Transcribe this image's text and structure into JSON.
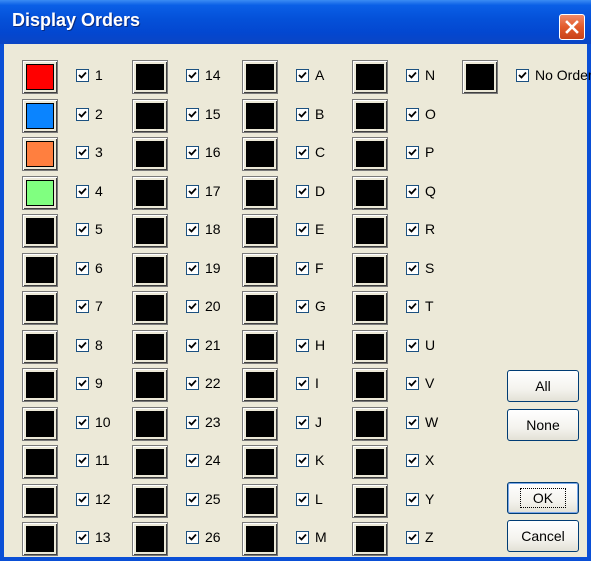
{
  "window": {
    "title": "Display Orders"
  },
  "colors": {
    "title_bar": "#0450d8",
    "close_button": "#e25a2a",
    "face": "#ece9d8"
  },
  "icons": {
    "close": "close-x-icon",
    "check": "checkmark-icon"
  },
  "orders": [
    {
      "label": "1",
      "color": "#ff0000",
      "checked": true
    },
    {
      "label": "2",
      "color": "#0a84ff",
      "checked": true
    },
    {
      "label": "3",
      "color": "#ff7f3f",
      "checked": true
    },
    {
      "label": "4",
      "color": "#80ff80",
      "checked": true
    },
    {
      "label": "5",
      "color": "#000000",
      "checked": true
    },
    {
      "label": "6",
      "color": "#000000",
      "checked": true
    },
    {
      "label": "7",
      "color": "#000000",
      "checked": true
    },
    {
      "label": "8",
      "color": "#000000",
      "checked": true
    },
    {
      "label": "9",
      "color": "#000000",
      "checked": true
    },
    {
      "label": "10",
      "color": "#000000",
      "checked": true
    },
    {
      "label": "11",
      "color": "#000000",
      "checked": true
    },
    {
      "label": "12",
      "color": "#000000",
      "checked": true
    },
    {
      "label": "13",
      "color": "#000000",
      "checked": true
    },
    {
      "label": "14",
      "color": "#000000",
      "checked": true
    },
    {
      "label": "15",
      "color": "#000000",
      "checked": true
    },
    {
      "label": "16",
      "color": "#000000",
      "checked": true
    },
    {
      "label": "17",
      "color": "#000000",
      "checked": true
    },
    {
      "label": "18",
      "color": "#000000",
      "checked": true
    },
    {
      "label": "19",
      "color": "#000000",
      "checked": true
    },
    {
      "label": "20",
      "color": "#000000",
      "checked": true
    },
    {
      "label": "21",
      "color": "#000000",
      "checked": true
    },
    {
      "label": "22",
      "color": "#000000",
      "checked": true
    },
    {
      "label": "23",
      "color": "#000000",
      "checked": true
    },
    {
      "label": "24",
      "color": "#000000",
      "checked": true
    },
    {
      "label": "25",
      "color": "#000000",
      "checked": true
    },
    {
      "label": "26",
      "color": "#000000",
      "checked": true
    },
    {
      "label": "A",
      "color": "#000000",
      "checked": true
    },
    {
      "label": "B",
      "color": "#000000",
      "checked": true
    },
    {
      "label": "C",
      "color": "#000000",
      "checked": true
    },
    {
      "label": "D",
      "color": "#000000",
      "checked": true
    },
    {
      "label": "E",
      "color": "#000000",
      "checked": true
    },
    {
      "label": "F",
      "color": "#000000",
      "checked": true
    },
    {
      "label": "G",
      "color": "#000000",
      "checked": true
    },
    {
      "label": "H",
      "color": "#000000",
      "checked": true
    },
    {
      "label": "I",
      "color": "#000000",
      "checked": true
    },
    {
      "label": "J",
      "color": "#000000",
      "checked": true
    },
    {
      "label": "K",
      "color": "#000000",
      "checked": true
    },
    {
      "label": "L",
      "color": "#000000",
      "checked": true
    },
    {
      "label": "M",
      "color": "#000000",
      "checked": true
    },
    {
      "label": "N",
      "color": "#000000",
      "checked": true
    },
    {
      "label": "O",
      "color": "#000000",
      "checked": true
    },
    {
      "label": "P",
      "color": "#000000",
      "checked": true
    },
    {
      "label": "Q",
      "color": "#000000",
      "checked": true
    },
    {
      "label": "R",
      "color": "#000000",
      "checked": true
    },
    {
      "label": "S",
      "color": "#000000",
      "checked": true
    },
    {
      "label": "T",
      "color": "#000000",
      "checked": true
    },
    {
      "label": "U",
      "color": "#000000",
      "checked": true
    },
    {
      "label": "V",
      "color": "#000000",
      "checked": true
    },
    {
      "label": "W",
      "color": "#000000",
      "checked": true
    },
    {
      "label": "X",
      "color": "#000000",
      "checked": true
    },
    {
      "label": "Y",
      "color": "#000000",
      "checked": true
    },
    {
      "label": "Z",
      "color": "#000000",
      "checked": true
    }
  ],
  "no_order": {
    "label": "No Order",
    "color": "#000000",
    "checked": true
  },
  "buttons": {
    "all": "All",
    "none": "None",
    "ok": "OK",
    "cancel": "Cancel"
  }
}
